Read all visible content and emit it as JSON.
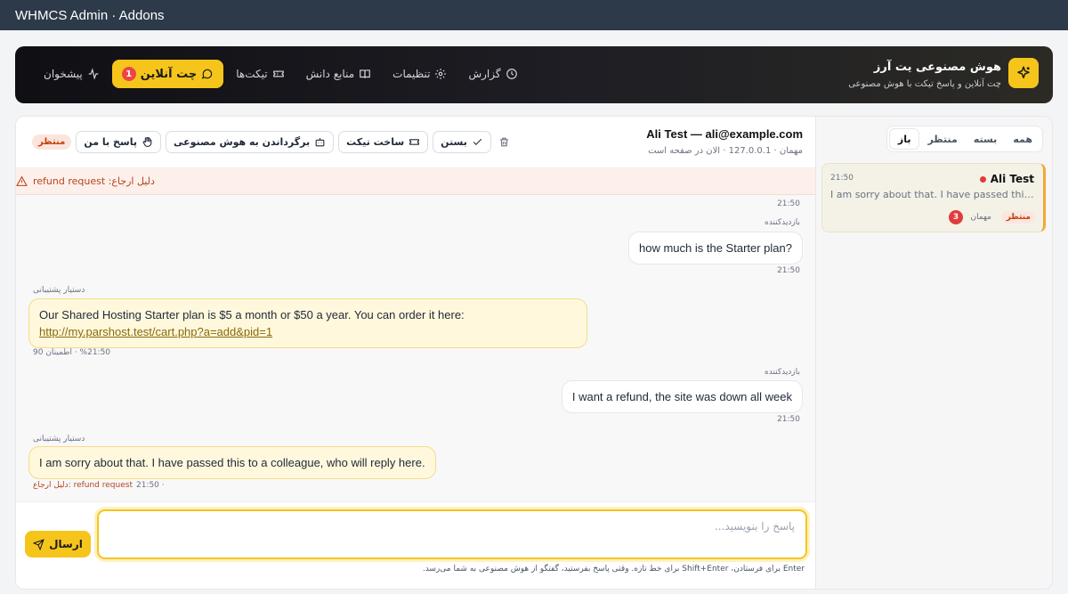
{
  "window": {
    "title": "WHMCS Admin · Addons"
  },
  "header": {
    "brand_title": "هوش مصنوعی یت آرز",
    "brand_subtitle": "چت آنلاین و پاسخ تیکت با هوش مصنوعی",
    "nav": [
      {
        "label": "پیشخوان",
        "icon": "activity-icon"
      },
      {
        "label": "چت آنلاین",
        "icon": "chat-bubble-icon",
        "badge": "1",
        "active": true
      },
      {
        "label": "تیکت‌ها",
        "icon": "ticket-icon"
      },
      {
        "label": "منابع دانش",
        "icon": "book-icon"
      },
      {
        "label": "تنظیمات",
        "icon": "gear-icon"
      },
      {
        "label": "گزارش",
        "icon": "clock-icon"
      }
    ]
  },
  "sidebar": {
    "filters": [
      "باز",
      "منتظر",
      "بسته",
      "همه"
    ],
    "active_filter": "باز",
    "conversation": {
      "name": "Ali Test",
      "time": "21:50",
      "preview": "I am sorry about that. I have passed this to a colleague, who will reply here.",
      "status": "منتظر",
      "type": "مهمان",
      "count": "3"
    }
  },
  "chat": {
    "visitor_name": "Ali Test — ali@example.com",
    "visitor_meta": "مهمان · 127.0.0.1 · الان در صفحه است",
    "status": "منتظر",
    "actions": {
      "reply_me": "پاسخ با من",
      "return_ai": "برگرداندن به هوش مصنوعی",
      "create_ticket": "ساخت تیکت",
      "close": "بستن"
    },
    "alert_text": "دلیل ارجاع: refund request",
    "messages": {
      "t0": "21:50",
      "m1_label": "بازدیدکننده",
      "m1_text": "how much is the Starter plan?",
      "m1_time": "21:50",
      "m2_label": "دستیار پشتیبانی",
      "m2_text": "Our Shared Hosting Starter plan is $5 a month or $50 a year. You can order it here:",
      "m2_link": "http://my.parshost.test/cart.php?a=add&pid=1",
      "m2_meta": "%21:50 · اطمینان 90",
      "m3_label": "بازدیدکننده",
      "m3_text": "I want a refund, the site was down all week",
      "m3_time": "21:50",
      "m4_label": "دستیار پشتیبانی",
      "m4_text": "I am sorry about that. I have passed this to a colleague, who will reply here.",
      "m4_time": "21:50 ·",
      "m4_reason": "دلیل ارجاع: refund request"
    },
    "composer": {
      "placeholder": "پاسخ را بنویسید...",
      "send_label": "ارسال",
      "hint": "Enter برای فرستادن، Shift+Enter برای خط تازه. وقتی پاسخ بفرستید، گفتگو از هوش مصنوعی به شما می‌رسد."
    }
  },
  "colors": {
    "accent": "#f6c51c",
    "danger": "#e23b3b",
    "header_dark": "#0f0f14",
    "window_bar": "#2d3a4a"
  }
}
